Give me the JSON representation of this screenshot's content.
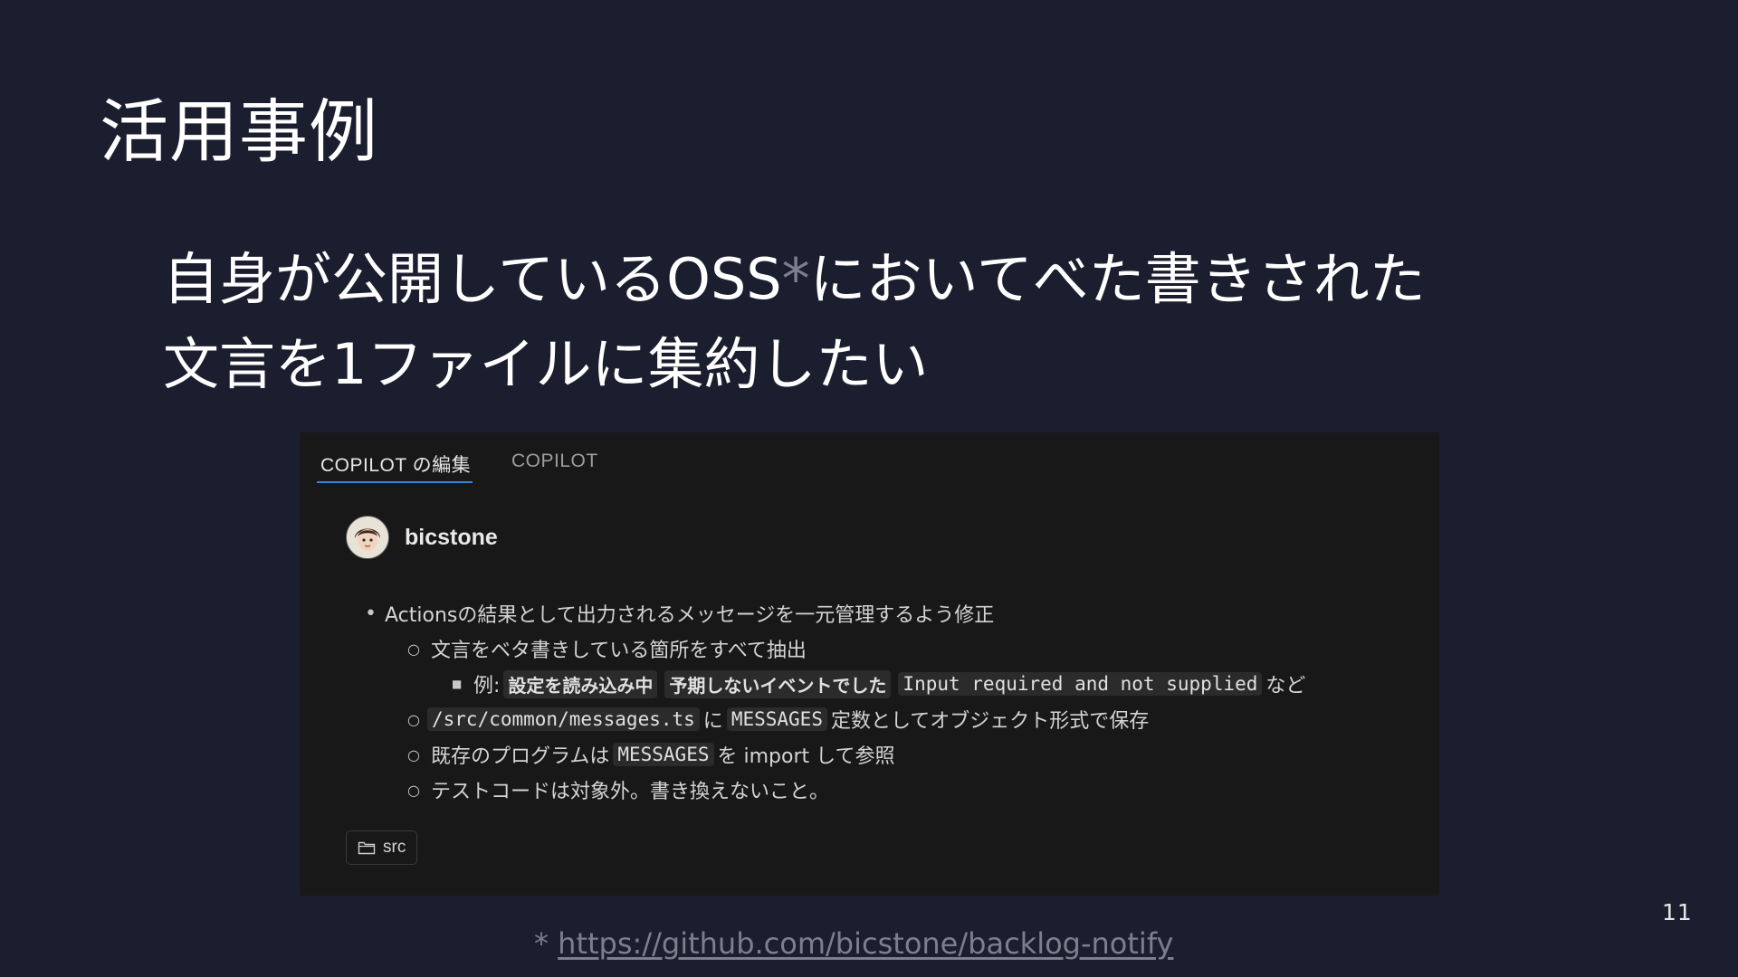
{
  "slide": {
    "title": "活用事例",
    "lead_line1": "自身が公開しているOSS",
    "lead_asterisk": "*",
    "lead_line1_end": "においてべた書きされた",
    "lead_line2": "文言を1ファイルに集約したい",
    "page_number": "11",
    "footnote_mark": "*",
    "footnote_url": "https://github.com/bicstone/backlog-notify"
  },
  "panel": {
    "tabs": [
      {
        "label": "COPILOT の編集",
        "active": true
      },
      {
        "label": "COPILOT",
        "active": false
      }
    ],
    "author": {
      "name": "bicstone",
      "avatar_icon": "avatar-icon"
    },
    "items": [
      {
        "text": "Actionsの結果として出力されるメッセージを一元管理するよう修正"
      },
      {
        "text": "文言をベタ書きしている箇所をすべて抽出"
      },
      {
        "prefix": "例:",
        "code1": "設定を読み込み中",
        "code2": "予期しないイベントでした",
        "code3": "Input required and not supplied",
        "suffix": "など"
      },
      {
        "code1": "/src/common/messages.ts",
        "mid": "に",
        "code2": "MESSAGES",
        "suffix": "定数としてオブジェクト形式で保存"
      },
      {
        "prefix": "既存のプログラムは",
        "code1": "MESSAGES",
        "suffix": "を import して参照"
      },
      {
        "text": "テストコードは対象外。書き換えないこと。"
      }
    ],
    "chip": {
      "label": "src",
      "icon": "folder-icon"
    }
  },
  "colors": {
    "background": "#1b1e2e",
    "panel": "#181818",
    "tab_underline": "#3b82d6",
    "muted": "#7c7f8c"
  }
}
